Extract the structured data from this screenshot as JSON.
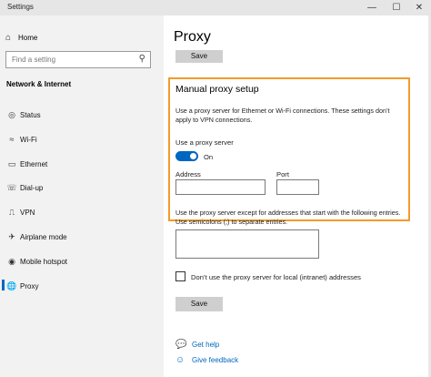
{
  "window": {
    "title": "Settings"
  },
  "sidebar": {
    "home_label": "Home",
    "search_placeholder": "Find a setting",
    "section_title": "Network & Internet",
    "items": [
      {
        "label": "Status"
      },
      {
        "label": "Wi-Fi"
      },
      {
        "label": "Ethernet"
      },
      {
        "label": "Dial-up"
      },
      {
        "label": "VPN"
      },
      {
        "label": "Airplane mode"
      },
      {
        "label": "Mobile hotspot"
      },
      {
        "label": "Proxy"
      }
    ]
  },
  "main": {
    "title": "Proxy",
    "top_save_label": "Save",
    "manual": {
      "heading": "Manual proxy setup",
      "description": "Use a proxy server for Ethernet or Wi-Fi connections. These settings don’t apply to VPN connections.",
      "use_proxy_label": "Use a proxy server",
      "toggle_state": "On",
      "address_label": "Address",
      "address_value": "",
      "port_label": "Port",
      "port_value": ""
    },
    "exceptions_description": "Use the proxy server except for addresses that start with the following entries. Use semicolons (;) to separate entries.",
    "exceptions_value": "",
    "local_checkbox_label": "Don’t use the proxy server for local (intranet) addresses",
    "bottom_save_label": "Save",
    "links": {
      "help": "Get help",
      "feedback": "Give feedback"
    }
  },
  "colors": {
    "accent": "#0067c0",
    "highlight": "#f39b2a"
  }
}
